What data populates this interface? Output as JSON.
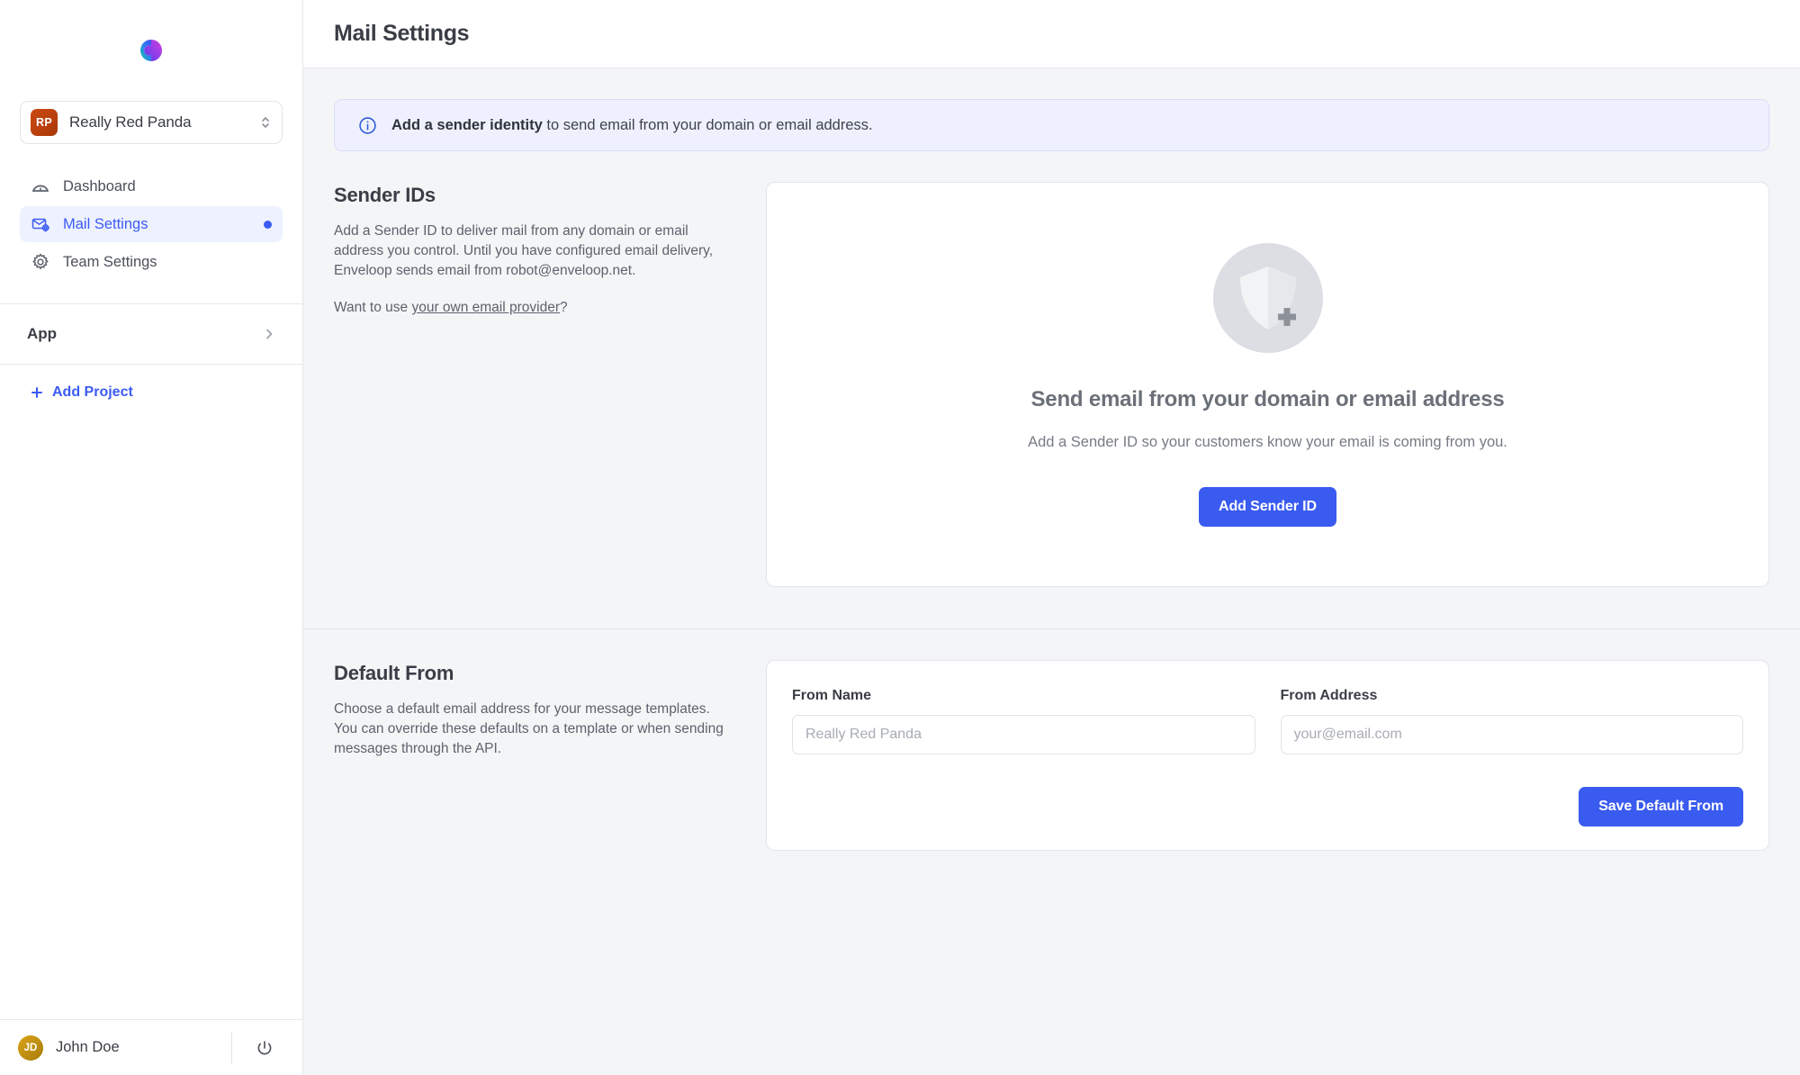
{
  "sidebar": {
    "logo_icon": "enveloop-infinity-logo",
    "org": {
      "initials": "RP",
      "name": "Really Red Panda",
      "switcher_icon": "chevron-up-down-icon"
    },
    "nav": [
      {
        "label": "Dashboard",
        "icon": "gauge-icon",
        "active": false,
        "badge": false
      },
      {
        "label": "Mail Settings",
        "icon": "mail-gear-icon",
        "active": true,
        "badge": true
      },
      {
        "label": "Team Settings",
        "icon": "gear-icon",
        "active": false,
        "badge": false
      }
    ],
    "app_group": {
      "label": "App",
      "icon": "chevron-right-icon"
    },
    "add_project": {
      "label": "Add Project",
      "icon": "plus-icon"
    },
    "user": {
      "initials": "JD",
      "name": "John Doe",
      "logout_icon": "power-icon"
    }
  },
  "header": {
    "title": "Mail Settings"
  },
  "banner": {
    "icon": "info-circle-icon",
    "bold_text": "Add a sender identity",
    "text": " to send email from your domain or email address."
  },
  "sender_ids": {
    "title": "Sender IDs",
    "description": "Add a Sender ID to deliver mail from any domain or email address you control. Until you have configured email delivery, Enveloop sends email from robot@enveloop.net.",
    "link_prefix": "Want to use ",
    "link_text": "your own email provider",
    "link_suffix": "?",
    "empty_state": {
      "icon": "shield-plus-icon",
      "title": "Send email from your domain or email address",
      "subtitle": "Add a Sender ID so your customers know your email is coming from you.",
      "button_label": "Add Sender ID"
    }
  },
  "default_from": {
    "title": "Default From",
    "description": "Choose a default email address for your message templates. You can override these defaults on a template or when sending messages through the API.",
    "fields": [
      {
        "label": "From Name",
        "value": "",
        "placeholder": "Really Red Panda"
      },
      {
        "label": "From Address",
        "value": "",
        "placeholder": "your@email.com"
      }
    ],
    "save_label": "Save Default From"
  },
  "colors": {
    "accent": "#3a5bf0",
    "accent_soft": "#eef1fe",
    "org_badge": "#cc4a12",
    "avatar": "#d9a218",
    "page_bg": "#f4f5f7",
    "text": "#3a3d45"
  }
}
